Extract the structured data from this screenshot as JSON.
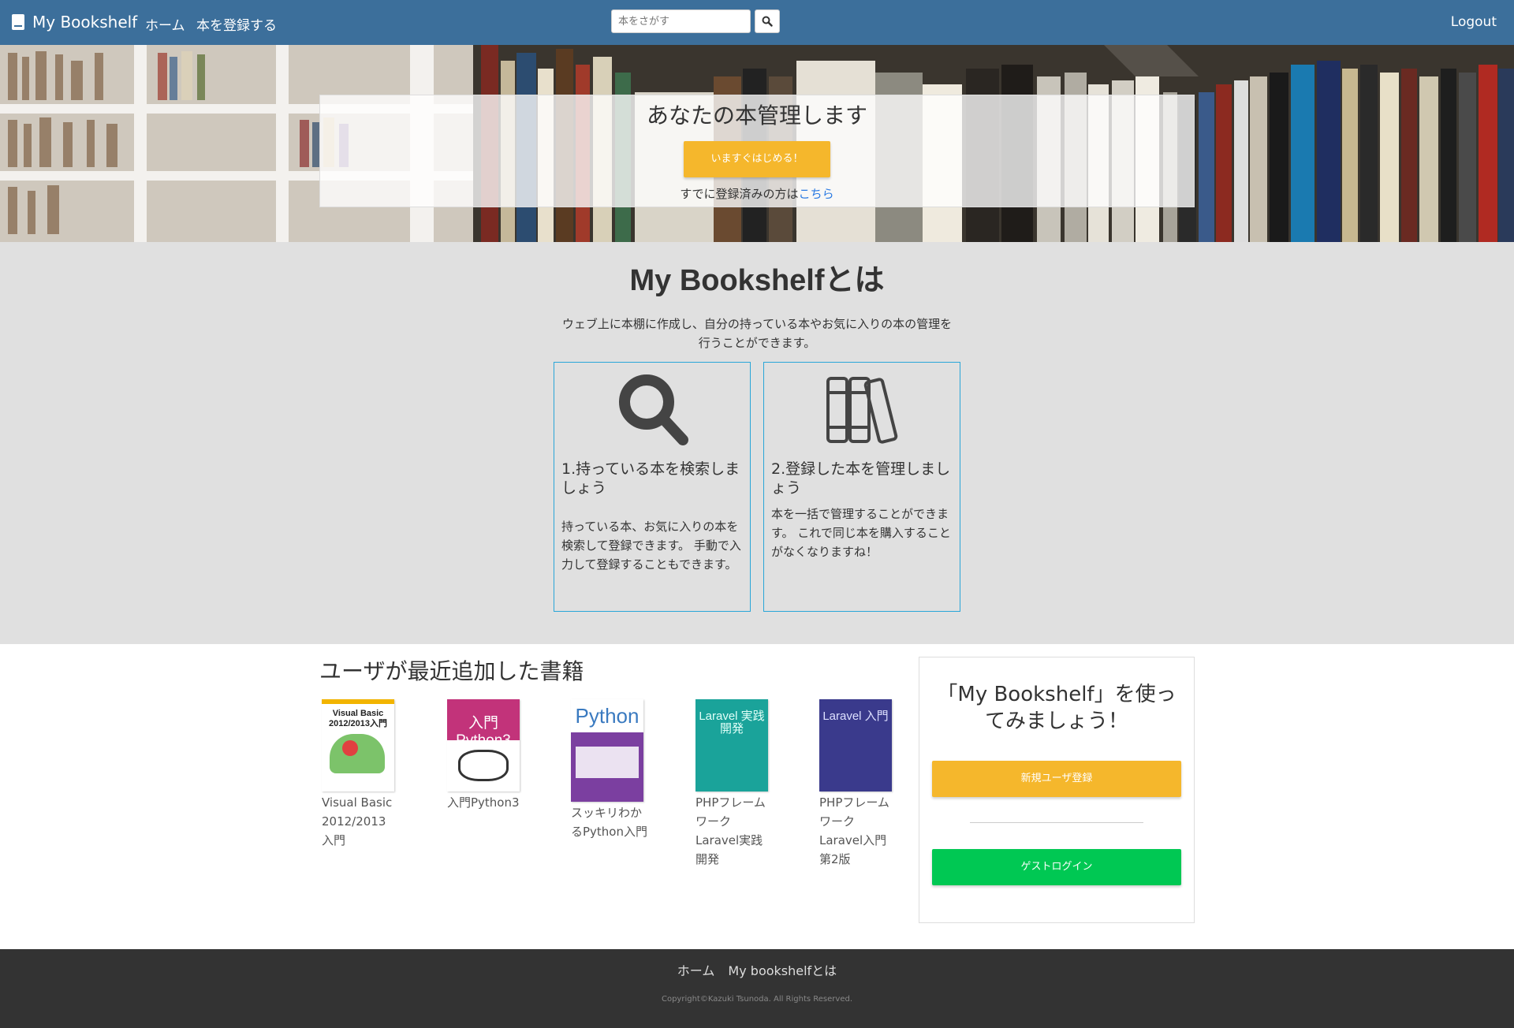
{
  "navbar": {
    "brand": "My Bookshelf",
    "home": "ホーム",
    "register_book": "本を登録する",
    "search_placeholder": "本をさがす",
    "logout": "Logout"
  },
  "hero": {
    "title": "あなたの本管理します",
    "start_button": "いますぐはじめる！",
    "already_registered": "すでに登録済みの方は",
    "here_link": "こちら"
  },
  "about": {
    "title": "My Bookshelfとは",
    "description": "ウェブ上に本棚に作成し、自分の持っている本やお気に入りの本の管理を行うことができます。",
    "features": [
      {
        "icon": "search-icon",
        "title": "1.持っている本を検索しましょう",
        "text": "持っている本、お気に入りの本を検索して登録できます。 手動で入力して登録することもできます。"
      },
      {
        "icon": "books-icon",
        "title": "2.登録した本を管理しましょう",
        "text": "本を一括で管理することができます。 これで同じ本を購入することがなくなりますね！"
      }
    ]
  },
  "recent": {
    "title": "ユーザが最近追加した書籍",
    "books": [
      {
        "title": "Visual Basic 2012/2013 入門",
        "cover_text": "Visual Basic 2012/2013入門",
        "cover_color": "#ffffff"
      },
      {
        "title": "入門Python3",
        "cover_text": "入門 Python3",
        "cover_color": "#c2337a"
      },
      {
        "title": "スッキリわかるPython入門",
        "cover_text": "Python",
        "cover_color": "#7b3fa0"
      },
      {
        "title": "PHPフレームワークLaravel実践開発",
        "cover_text": "Laravel 実践開発",
        "cover_color": "#1aa39a"
      },
      {
        "title": "PHPフレームワークLaravel入門 第2版",
        "cover_text": "Laravel 入門",
        "cover_color": "#3a3a8c"
      }
    ]
  },
  "cta": {
    "title": "「My Bookshelf」を使ってみましょう！",
    "signup": "新規ユーザ登録",
    "guest": "ゲストログイン"
  },
  "footer": {
    "home": "ホーム",
    "about": "My bookshelfとは",
    "copyright": "Copyright©Kazuki Tsunoda. All Rights Reserved."
  }
}
